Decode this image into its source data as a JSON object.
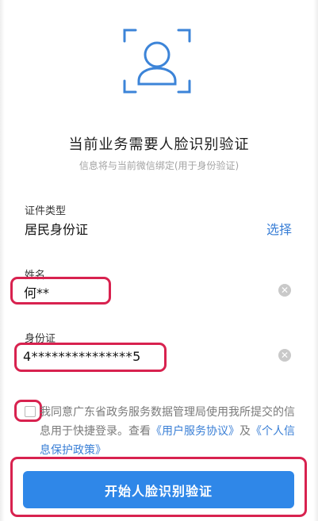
{
  "header": {
    "title": "当前业务需要人脸识别验证",
    "subtitle": "信息将与当前微信绑定(用于身份验证)"
  },
  "form": {
    "id_type": {
      "label": "证件类型",
      "value": "居民身份证",
      "action": "选择"
    },
    "name": {
      "label": "姓名",
      "value": "何**"
    },
    "id_number": {
      "label": "身份证",
      "value": "4***************5"
    }
  },
  "agreement": {
    "text_1": "我同意广东省政务服务数据管理局使用我所提交的信息用于快捷登录。查看",
    "link_1": "《用户服务协议》",
    "text_2": "及",
    "link_2": "《个人信息保护政策》"
  },
  "button": {
    "start_label": "开始人脸识别验证"
  },
  "colors": {
    "accent": "#2f87e8",
    "link": "#3a7fd6",
    "highlight": "#d8224f",
    "icon": "#3c84d8"
  }
}
